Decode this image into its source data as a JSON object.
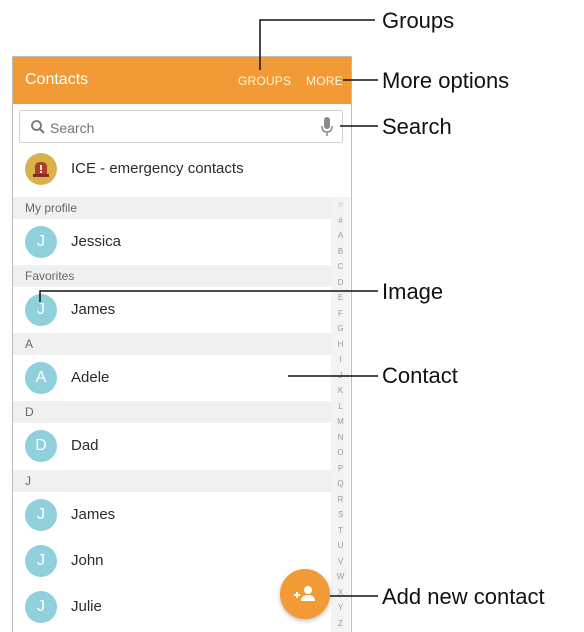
{
  "appbar": {
    "title": "Contacts",
    "groups_label": "GROUPS",
    "more_label": "MORE"
  },
  "search": {
    "placeholder": "Search"
  },
  "ice": {
    "label": "ICE - emergency contacts"
  },
  "sections": {
    "my_profile": "My profile",
    "favorites": "Favorites",
    "a": "A",
    "d": "D",
    "j": "J"
  },
  "contacts": {
    "jessica": {
      "initial": "J",
      "name": "Jessica"
    },
    "james_fav": {
      "initial": "J",
      "name": "James"
    },
    "adele": {
      "initial": "A",
      "name": "Adele"
    },
    "dad": {
      "initial": "D",
      "name": "Dad"
    },
    "james": {
      "initial": "J",
      "name": "James"
    },
    "john": {
      "initial": "J",
      "name": "John"
    },
    "julie": {
      "initial": "J",
      "name": "Julie"
    }
  },
  "index_letters": [
    "☆",
    "#",
    "A",
    "B",
    "C",
    "D",
    "E",
    "F",
    "G",
    "H",
    "I",
    "J",
    "K",
    "L",
    "M",
    "N",
    "O",
    "P",
    "Q",
    "R",
    "S",
    "T",
    "U",
    "V",
    "W",
    "X",
    "Y",
    "Z"
  ],
  "callouts": {
    "groups": "Groups",
    "more_options": "More options",
    "search": "Search",
    "image": "Image",
    "contact": "Contact",
    "add_new_contact": "Add new contact"
  },
  "colors": {
    "accent": "#f29a35",
    "avatar": "#8fd0dc",
    "ice": "#d9b04a"
  }
}
